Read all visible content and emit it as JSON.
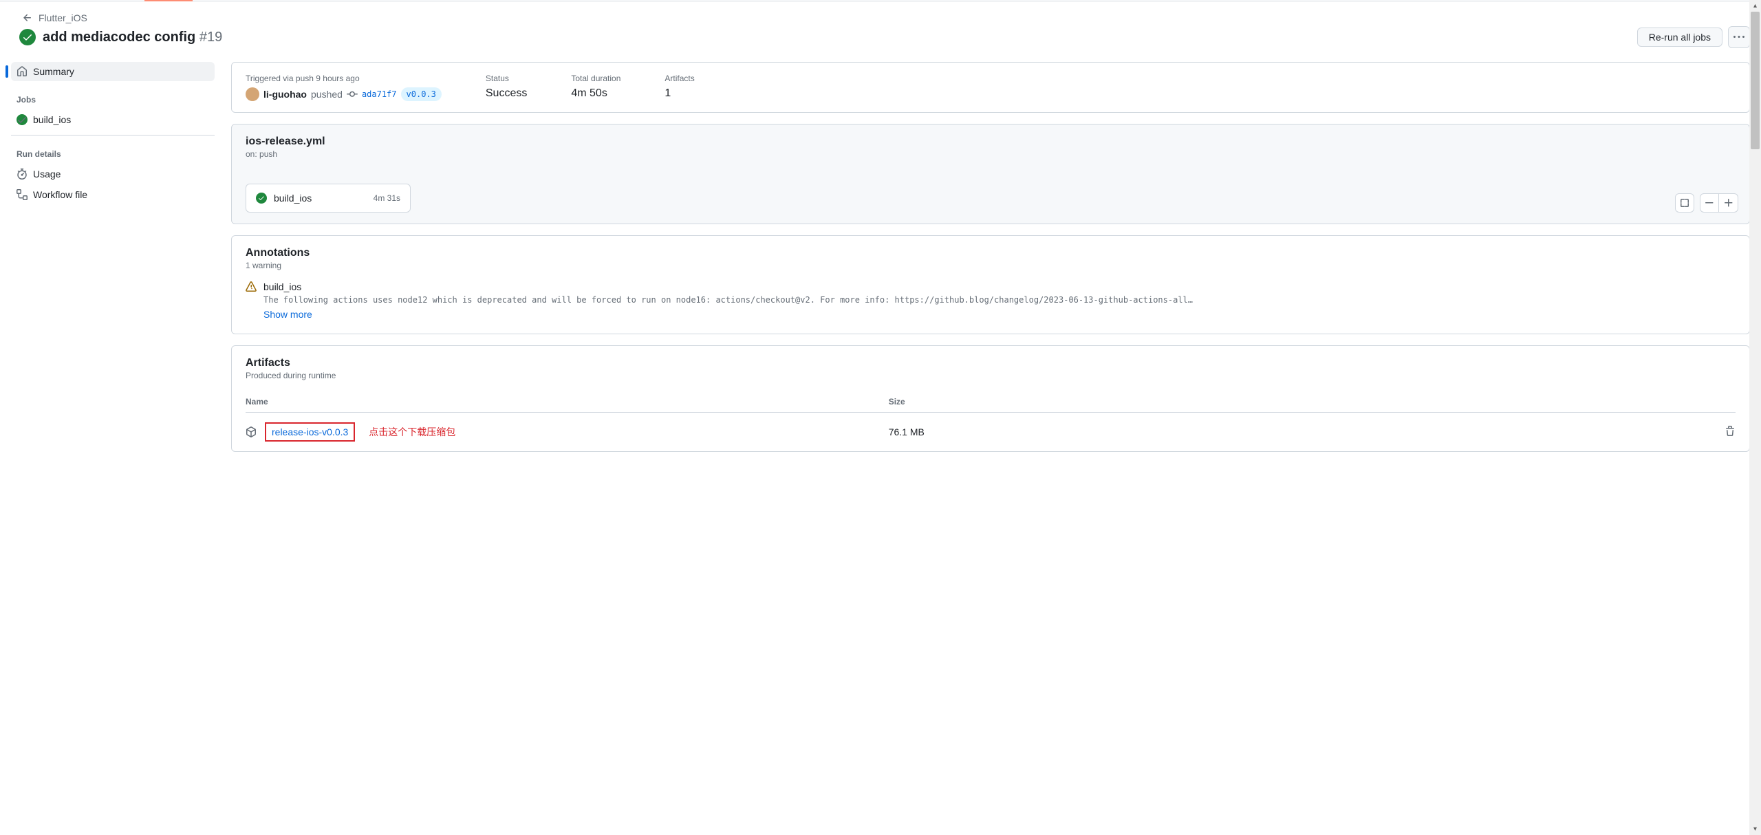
{
  "breadcrumb": {
    "workflow": "Flutter_iOS"
  },
  "run": {
    "title": "add mediacodec config",
    "number": "#19",
    "rerun_label": "Re-run all jobs"
  },
  "sidebar": {
    "summary": "Summary",
    "jobs_heading": "Jobs",
    "jobs": [
      {
        "name": "build_ios"
      }
    ],
    "run_details_heading": "Run details",
    "usage": "Usage",
    "workflow_file": "Workflow file"
  },
  "summary": {
    "triggered_label": "Triggered via push 9 hours ago",
    "user": "li-guohao",
    "pushed_verb": "pushed",
    "sha": "ada71f7",
    "tag": "v0.0.3",
    "status_label": "Status",
    "status_value": "Success",
    "duration_label": "Total duration",
    "duration_value": "4m 50s",
    "artifacts_label": "Artifacts",
    "artifacts_value": "1"
  },
  "workflow": {
    "file": "ios-release.yml",
    "on": "on: push",
    "job_name": "build_ios",
    "job_duration": "4m 31s"
  },
  "annotations": {
    "title": "Annotations",
    "subtitle": "1 warning",
    "job": "build_ios",
    "message": "The following actions uses node12 which is deprecated and will be forced to run on node16: actions/checkout@v2. For more info: https://github.blog/changelog/2023-06-13-github-actions-all…",
    "show_more": "Show more"
  },
  "artifacts": {
    "title": "Artifacts",
    "subtitle": "Produced during runtime",
    "cols": {
      "name": "Name",
      "size": "Size"
    },
    "rows": [
      {
        "name": "release-ios-v0.0.3",
        "size": "76.1 MB"
      }
    ],
    "note": "点击这个下载压缩包"
  }
}
